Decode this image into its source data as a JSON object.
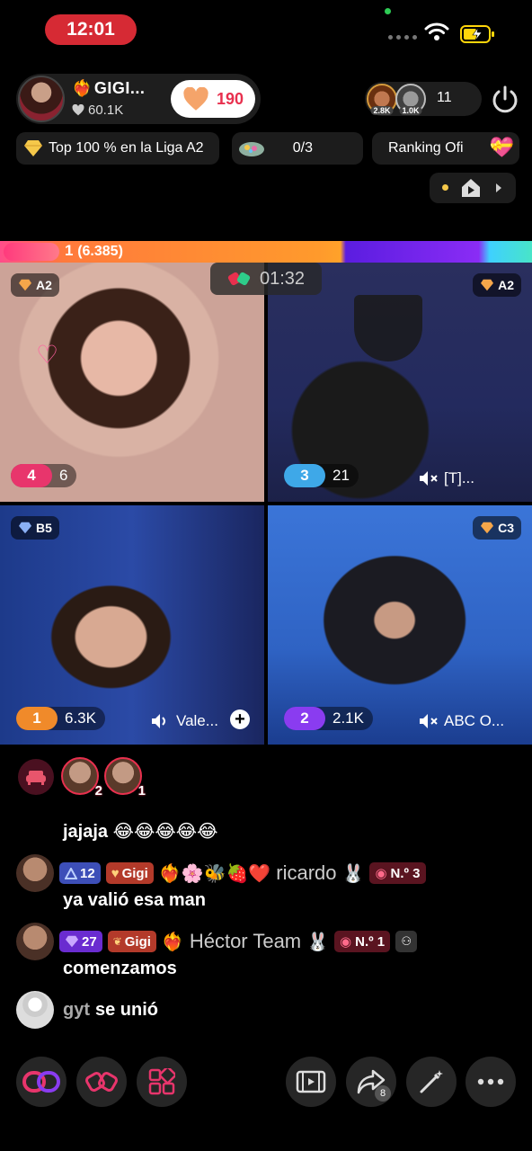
{
  "status": {
    "time": "12:01"
  },
  "host": {
    "name": "GIGI...",
    "likes": "60.1K",
    "follow_count": "190"
  },
  "viewers": {
    "avatar_1_label": "2.8K",
    "avatar_2_label": "1.0K",
    "count": "11"
  },
  "chips": {
    "league": "Top 100 % en la Liga A2",
    "tasks_progress": "0/3",
    "ranking": "Ranking Ofi"
  },
  "battle": {
    "leader_rank": "1",
    "leader_points": "(6.385)",
    "timer": "01:32"
  },
  "tiles": [
    {
      "league": "A2",
      "rank": "4",
      "score": "6",
      "label": "",
      "muted": false
    },
    {
      "league": "A2",
      "rank": "3",
      "score": "21",
      "label": "[T]...",
      "muted": true
    },
    {
      "league": "B5",
      "rank": "1",
      "score": "6.3K",
      "label": "Vale...",
      "muted": false
    },
    {
      "league": "C3",
      "rank": "2",
      "score": "2.1K",
      "label": "ABC O...",
      "muted": true
    }
  ],
  "guests": [
    {
      "count": "2"
    },
    {
      "count": "1"
    }
  ],
  "chat": [
    {
      "text": "jajaja 😂😂😂😂😂"
    },
    {
      "level": "12",
      "fan_name": "Gigi",
      "emojis": "❤️‍🔥🌸🐝🍓❤️",
      "user": "ricardo",
      "user_emoji": "🐰",
      "rank": "N.º 3",
      "text": "ya valió esa man"
    },
    {
      "level": "27",
      "fan_name": "Gigi",
      "emojis": "❤️‍🔥",
      "user": "Héctor Team",
      "user_emoji": "🐰",
      "rank": "N.º 1",
      "text": "comenzamos"
    },
    {
      "user": "gyt",
      "text": "se unió"
    }
  ],
  "toolbar": {
    "share_count": "8"
  },
  "colors": {
    "accent": "#e8304e",
    "rank_pink": "#e8356c",
    "rank_blue": "#3ea8e8",
    "rank_orange": "#f08a2a",
    "rank_purple": "#8a3cf0"
  }
}
